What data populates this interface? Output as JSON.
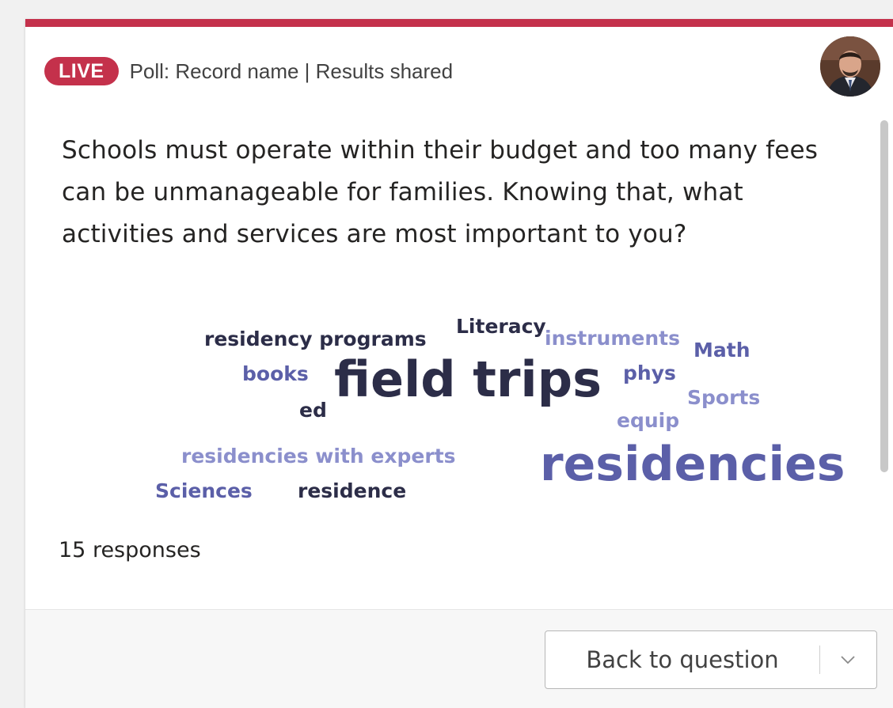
{
  "colors": {
    "accent": "#c4314b",
    "live_badge": "#c4314b",
    "word_dark": "#2c2d48",
    "word_mid": "#5b5fa8",
    "word_light": "#8b8fcc"
  },
  "header": {
    "live_label": "LIVE",
    "meta": "Poll: Record name | Results shared"
  },
  "question": "Schools must operate within their budget and too many fees can be unmanageable for families. Knowing that, what activities and services are most important to you?",
  "word_cloud": [
    {
      "text": "residency programs",
      "tone": "dark"
    },
    {
      "text": "Literacy",
      "tone": "dark"
    },
    {
      "text": "instruments",
      "tone": "light"
    },
    {
      "text": "Math",
      "tone": "mid"
    },
    {
      "text": "books",
      "tone": "mid"
    },
    {
      "text": "field trips",
      "tone": "dark"
    },
    {
      "text": "phys",
      "tone": "mid"
    },
    {
      "text": "ed",
      "tone": "dark"
    },
    {
      "text": "Sports",
      "tone": "light"
    },
    {
      "text": "equip",
      "tone": "light"
    },
    {
      "text": "residencies with experts",
      "tone": "light"
    },
    {
      "text": "residencies",
      "tone": "mid"
    },
    {
      "text": "Sciences",
      "tone": "mid"
    },
    {
      "text": "residence",
      "tone": "dark"
    }
  ],
  "responses": "15 responses",
  "footer": {
    "back_button_label": "Back to question",
    "dropdown_icon": "chevron-down-icon"
  }
}
